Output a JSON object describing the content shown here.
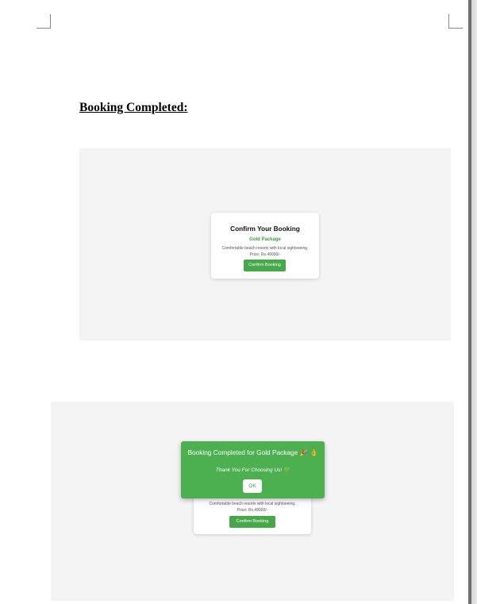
{
  "document": {
    "heading": "Booking Completed:"
  },
  "screenshot_1": {
    "card": {
      "title": "Confirm Your Booking",
      "package_name": "Gold Package",
      "description": "Comfortable beach resorts with local sightseeing.",
      "price": "Price: Rs.49000/-",
      "button_label": "Confirm Booking"
    }
  },
  "screenshot_2": {
    "dialog": {
      "title": "Booking Completed for Gold Package 🎉 👌",
      "subtitle": "Thank You For Choosing Us! 💚",
      "ok_label": "OK"
    },
    "card": {
      "description": "Comfortable beach resorts with local sightseeing.",
      "price": "Price: Rs.49000/-",
      "button_label": "Confirm Booking"
    }
  },
  "colors": {
    "accent_green": "#4caf50",
    "button_green": "#46a84a",
    "screenshot_bg": "#f4f4f4"
  }
}
